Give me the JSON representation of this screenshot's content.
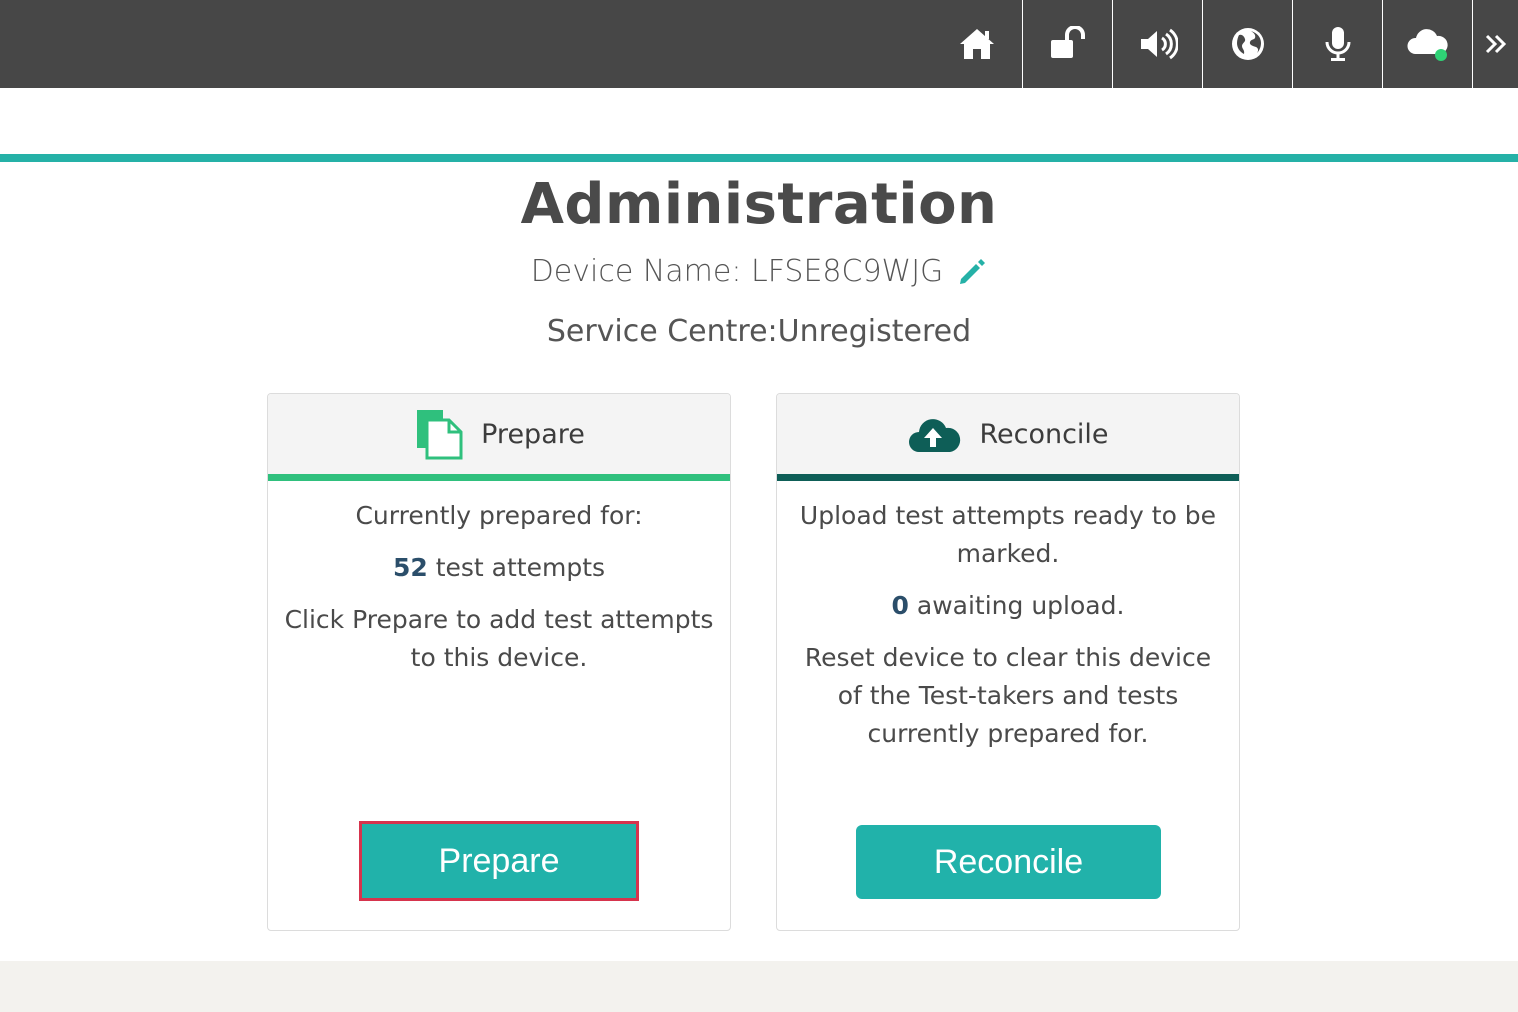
{
  "header": {
    "icons": [
      {
        "name": "home-icon"
      },
      {
        "name": "unlock-icon"
      },
      {
        "name": "volume-icon"
      },
      {
        "name": "globe-icon"
      },
      {
        "name": "microphone-icon"
      },
      {
        "name": "cloud-status-icon"
      },
      {
        "name": "double-chevron-right-icon"
      }
    ],
    "status_dot_color": "#2fd175"
  },
  "page": {
    "title": "Administration",
    "device_label": "Device Name:",
    "device_name": "LFSE8C9WJG",
    "service_label": "Service Centre:",
    "service_value": "Unregistered"
  },
  "prepare_card": {
    "title": "Prepare",
    "accent_color": "#2fc07d",
    "line1": "Currently prepared for:",
    "count": "52",
    "count_suffix": " test attempts",
    "line3": "Click Prepare to add test attempts to this device.",
    "button_label": "Prepare"
  },
  "reconcile_card": {
    "title": "Reconcile",
    "accent_color": "#0e5e57",
    "line1": "Upload test attempts ready to be marked.",
    "count": "0",
    "count_suffix": " awaiting upload.",
    "line3": "Reset device to clear this device of the Test-takers and tests currently prepared for.",
    "button_label": "Reconcile"
  },
  "colors": {
    "topbar": "#474747",
    "teal": "#25b1a7",
    "button": "#21b2aa",
    "focus_outline": "#d6344d"
  }
}
